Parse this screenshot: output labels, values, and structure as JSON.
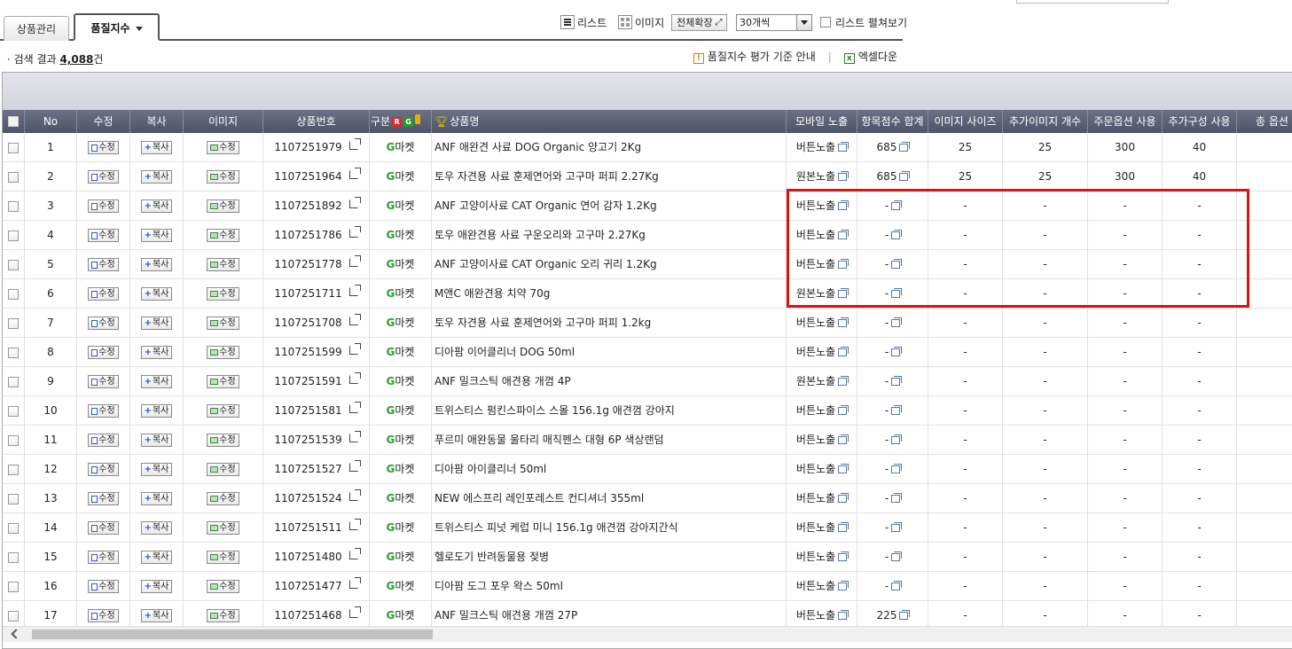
{
  "tabs": {
    "product_manage": "상품관리",
    "quality_index": "품질지수"
  },
  "view": {
    "list_label": "리스트",
    "image_label": "이미지",
    "expand_all": "전체확장",
    "per_page": "30개씩",
    "list_expand": "리스트 펼쳐보기"
  },
  "search": {
    "prefix": "· 검색 결과",
    "count": "4,088",
    "suffix": "건"
  },
  "links": {
    "guide": "품질지수 평가 기준 안내",
    "excel": "엑셀다운"
  },
  "header": {
    "no": "No",
    "edit": "수정",
    "copy": "복사",
    "image": "이미지",
    "product_no": "상품번호",
    "category": "구분",
    "badge_r": "R",
    "badge_g": "G",
    "product_name": "상품명",
    "mobile": "모바일 노출",
    "score_sum": "항목점수 합계",
    "image_size": "이미지 사이즈",
    "extra_images": "추가이미지 개수",
    "order_option": "주문옵션 사용",
    "extra_config": "추가구성 사용",
    "total_option": "총 옵션"
  },
  "buttons": {
    "edit": "수정",
    "copy": "복사",
    "image_edit": "수정"
  },
  "rows": [
    {
      "no": "1",
      "pid": "1107251979",
      "g": "G",
      "mkt": "마켓",
      "name": "ANF 애완견 사료 DOG Organic 양고기 2Kg",
      "mobile": "버튼노출",
      "score": "685",
      "size": "25",
      "extra": "25",
      "order": "300",
      "config": "40"
    },
    {
      "no": "2",
      "pid": "1107251964",
      "g": "G",
      "mkt": "마켓",
      "name": "토우 자견용 사료 훈제연어와 고구마 퍼피 2.27Kg",
      "mobile": "원본노출",
      "score": "685",
      "size": "25",
      "extra": "25",
      "order": "300",
      "config": "40"
    },
    {
      "no": "3",
      "pid": "1107251892",
      "g": "G",
      "mkt": "마켓",
      "name": "ANF 고양이사료 CAT Organic 연어 감자 1.2Kg",
      "mobile": "버튼노출",
      "score": "-",
      "size": "-",
      "extra": "-",
      "order": "-",
      "config": "-"
    },
    {
      "no": "4",
      "pid": "1107251786",
      "g": "G",
      "mkt": "마켓",
      "name": "토우 애완견용 사료 구운오리와 고구마 2.27Kg",
      "mobile": "버튼노출",
      "score": "-",
      "size": "-",
      "extra": "-",
      "order": "-",
      "config": "-"
    },
    {
      "no": "5",
      "pid": "1107251778",
      "g": "G",
      "mkt": "마켓",
      "name": "ANF 고양이사료 CAT Organic 오리 귀리 1.2Kg",
      "mobile": "버튼노출",
      "score": "-",
      "size": "-",
      "extra": "-",
      "order": "-",
      "config": "-"
    },
    {
      "no": "6",
      "pid": "1107251711",
      "g": "G",
      "mkt": "마켓",
      "name": "M앤C 애완견용 치약 70g",
      "mobile": "원본노출",
      "score": "-",
      "size": "-",
      "extra": "-",
      "order": "-",
      "config": "-"
    },
    {
      "no": "7",
      "pid": "1107251708",
      "g": "G",
      "mkt": "마켓",
      "name": "토우 자견용 사료 훈제연어와 고구마 퍼피 1.2kg",
      "mobile": "버튼노출",
      "score": "-",
      "size": "-",
      "extra": "-",
      "order": "-",
      "config": "-"
    },
    {
      "no": "8",
      "pid": "1107251599",
      "g": "G",
      "mkt": "마켓",
      "name": "디아팜 이어클리너 DOG 50ml",
      "mobile": "버튼노출",
      "score": "-",
      "size": "-",
      "extra": "-",
      "order": "-",
      "config": "-"
    },
    {
      "no": "9",
      "pid": "1107251591",
      "g": "G",
      "mkt": "마켓",
      "name": "ANF 밀크스틱 애견용 개껌 4P",
      "mobile": "원본노출",
      "score": "-",
      "size": "-",
      "extra": "-",
      "order": "-",
      "config": "-"
    },
    {
      "no": "10",
      "pid": "1107251581",
      "g": "G",
      "mkt": "마켓",
      "name": "트위스티스 펌킨스파이스 스몰 156.1g 애견껌 강아지",
      "mobile": "버튼노출",
      "score": "-",
      "size": "-",
      "extra": "-",
      "order": "-",
      "config": "-"
    },
    {
      "no": "11",
      "pid": "1107251539",
      "g": "G",
      "mkt": "마켓",
      "name": "푸르미 애완동물 울타리 매직펜스 대형 6P 색상랜덤",
      "mobile": "버튼노출",
      "score": "-",
      "size": "-",
      "extra": "-",
      "order": "-",
      "config": "-"
    },
    {
      "no": "12",
      "pid": "1107251527",
      "g": "G",
      "mkt": "마켓",
      "name": "디아팜 아이클리너 50ml",
      "mobile": "버튼노출",
      "score": "-",
      "size": "-",
      "extra": "-",
      "order": "-",
      "config": "-"
    },
    {
      "no": "13",
      "pid": "1107251524",
      "g": "G",
      "mkt": "마켓",
      "name": "NEW 에스프리 레인포레스트 컨디셔너 355ml",
      "mobile": "버튼노출",
      "score": "-",
      "size": "-",
      "extra": "-",
      "order": "-",
      "config": "-"
    },
    {
      "no": "14",
      "pid": "1107251511",
      "g": "G",
      "mkt": "마켓",
      "name": "트위스티스 피넛 케럽 미니 156.1g 애견껌 강아지간식",
      "mobile": "버튼노출",
      "score": "-",
      "size": "-",
      "extra": "-",
      "order": "-",
      "config": "-"
    },
    {
      "no": "15",
      "pid": "1107251480",
      "g": "G",
      "mkt": "마켓",
      "name": "헬로도기 반려동물용 젖병",
      "mobile": "버튼노출",
      "score": "-",
      "size": "-",
      "extra": "-",
      "order": "-",
      "config": "-"
    },
    {
      "no": "16",
      "pid": "1107251477",
      "g": "G",
      "mkt": "마켓",
      "name": "디아팜 도그 포우 왁스 50ml",
      "mobile": "버튼노출",
      "score": "-",
      "size": "-",
      "extra": "-",
      "order": "-",
      "config": "-"
    },
    {
      "no": "17",
      "pid": "1107251468",
      "g": "G",
      "mkt": "마켓",
      "name": "ANF 밀크스틱 애견용 개껌 27P",
      "mobile": "버튼노출",
      "score": "225",
      "size": "-",
      "extra": "-",
      "order": "-",
      "config": "-"
    }
  ],
  "colors": {
    "header_bg": "#5a6074",
    "highlight": "#e01010",
    "gmarket_green": "#2aa02a"
  }
}
